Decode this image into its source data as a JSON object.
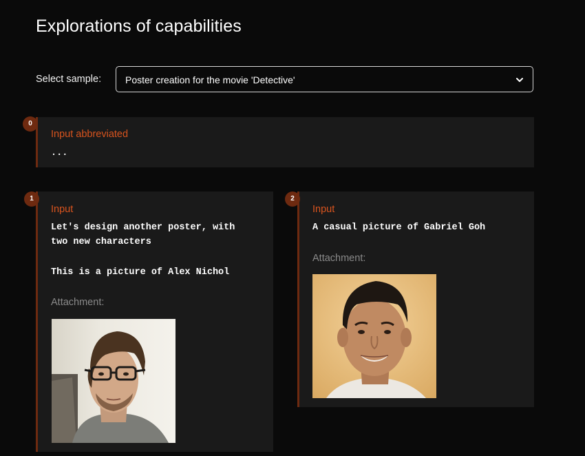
{
  "page": {
    "title": "Explorations of capabilities"
  },
  "selector": {
    "label": "Select sample:",
    "selected_value": "Poster creation for the movie 'Detective'"
  },
  "cards": [
    {
      "badge": "0",
      "label": "Input abbreviated",
      "text": "..."
    },
    {
      "badge": "1",
      "label": "Input",
      "text_line1": "Let's design another poster, with",
      "text_line2": "two new characters",
      "text_line3": "This is a picture of Alex Nichol",
      "attachment_label": "Attachment:"
    },
    {
      "badge": "2",
      "label": "Input",
      "text": "A casual picture of Gabriel Goh",
      "attachment_label": "Attachment:"
    }
  ],
  "colors": {
    "accent": "#d9541e",
    "rail": "#6e2a10",
    "card_bg": "#1a1a1a",
    "page_bg": "#0a0a0a"
  },
  "icons": {
    "select_arrow": "chevron-down-icon"
  }
}
